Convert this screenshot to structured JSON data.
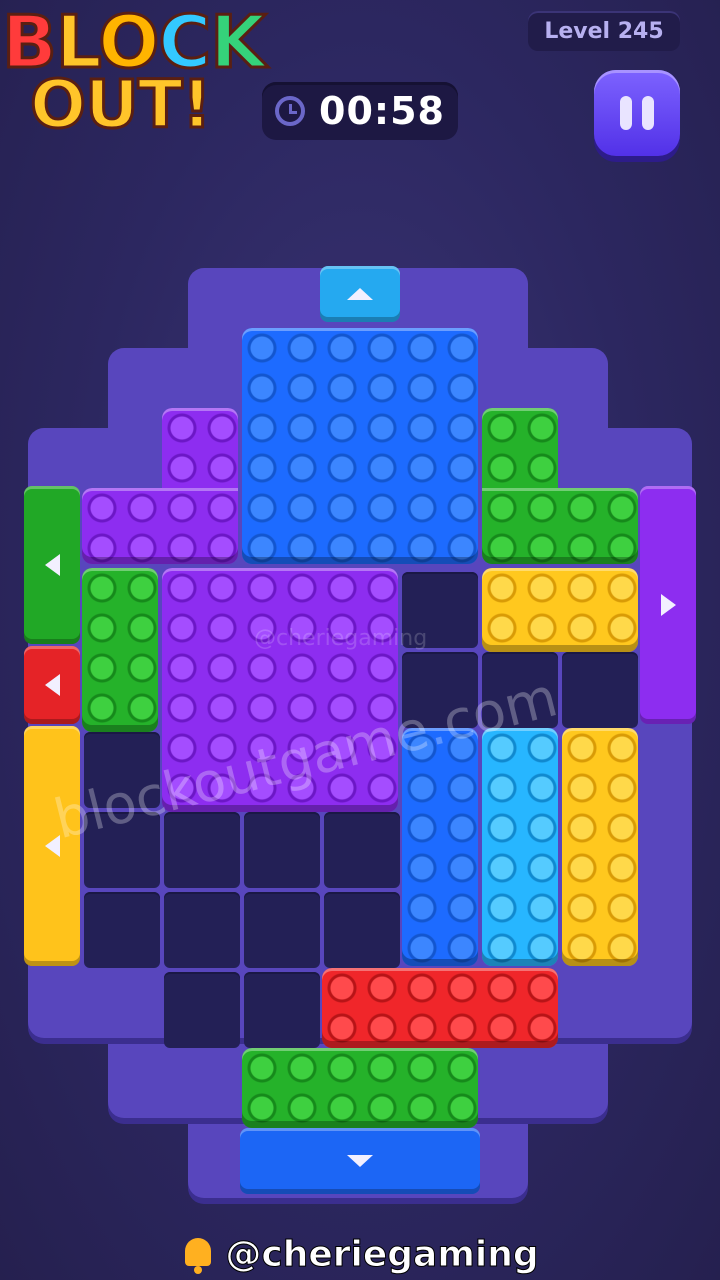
{
  "logo": {
    "line1": [
      "B",
      "L",
      "O",
      "C",
      "K"
    ],
    "line2": "OUT!"
  },
  "level": {
    "label": "Level 245"
  },
  "timer": {
    "value": "00:58",
    "icon": "clock-icon"
  },
  "pause": {
    "icon": "pause-icon"
  },
  "watermarks": {
    "main": "blockoutgame.com",
    "small": "@cheriegaming"
  },
  "footer": {
    "icon": "bell-icon",
    "handle": "@cheriegaming"
  },
  "colors": {
    "blue": "#1d6bff",
    "purple": "#8d2df0",
    "green": "#25b22a",
    "yellow": "#ffc81e",
    "cyan": "#27b6ff",
    "red": "#f0262a",
    "board_frame": "#5846bd",
    "empty_cell": "#232056"
  },
  "blocks": [
    {
      "id": "blue-top",
      "color": "blue"
    },
    {
      "id": "purple-l-top",
      "color": "purple"
    },
    {
      "id": "green-l-right",
      "color": "green"
    },
    {
      "id": "yellow-bar-right",
      "color": "yellow"
    },
    {
      "id": "green-left",
      "color": "green"
    },
    {
      "id": "purple-big",
      "color": "purple"
    },
    {
      "id": "blue-vertical",
      "color": "blue"
    },
    {
      "id": "cyan-vertical",
      "color": "cyan"
    },
    {
      "id": "yellow-vertical",
      "color": "yellow"
    },
    {
      "id": "red-bar",
      "color": "red"
    },
    {
      "id": "green-bottom",
      "color": "green"
    }
  ],
  "gates": [
    {
      "id": "gate-top",
      "color": "cyan",
      "direction": "up"
    },
    {
      "id": "gate-left-green",
      "color": "green",
      "direction": "left"
    },
    {
      "id": "gate-left-red",
      "color": "red",
      "direction": "left"
    },
    {
      "id": "gate-left-yellow",
      "color": "yellow",
      "direction": "left"
    },
    {
      "id": "gate-right-purple",
      "color": "purple",
      "direction": "right"
    },
    {
      "id": "gate-bottom",
      "color": "blue",
      "direction": "down"
    }
  ]
}
